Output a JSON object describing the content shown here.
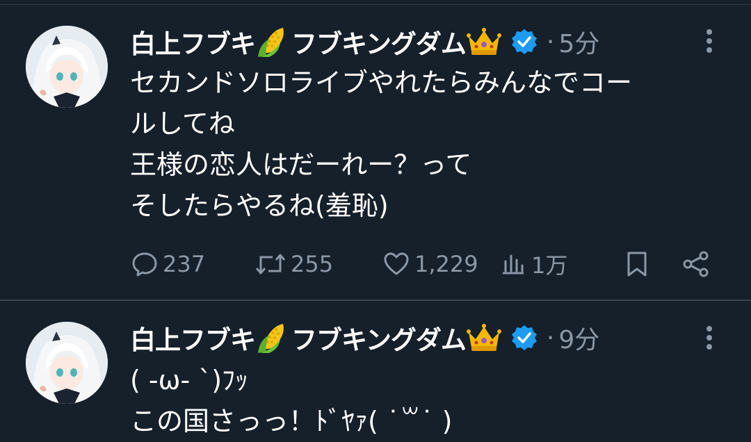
{
  "tweets": [
    {
      "author_name": "白上フブキ🌽フブキングダム👑",
      "time": "5分",
      "verified": true,
      "lines": [
        "セカンドソロライブやれたらみんなでコー",
        "ルしてね",
        "王様の恋人はだーれー？って",
        "そしたらやるね(羞恥)"
      ],
      "stats": {
        "replies": "237",
        "retweets": "255",
        "likes": "1,229",
        "views": "1万"
      }
    },
    {
      "author_name": "白上フブキ🌽フブキングダム👑",
      "time": "9分",
      "verified": true,
      "lines": [
        "( -ω- `)ﾌｯ",
        "この国さっっ！ﾄﾞﾔｧ( ˙꒳​˙ )"
      ]
    }
  ],
  "name_parts": {
    "part1": "白上フブキ",
    "part2": "フブキングダム"
  },
  "dot": "·",
  "icons": [
    "corn-emoji",
    "crown-emoji",
    "verified-badge-icon",
    "more-options-icon",
    "reply-icon",
    "retweet-icon",
    "like-icon",
    "views-icon",
    "bookmark-icon",
    "share-icon"
  ],
  "colors": {
    "background": "#15202b",
    "divider": "#38444d",
    "secondary_text": "#8b98a5",
    "verified_blue": "#1d9bf0"
  }
}
